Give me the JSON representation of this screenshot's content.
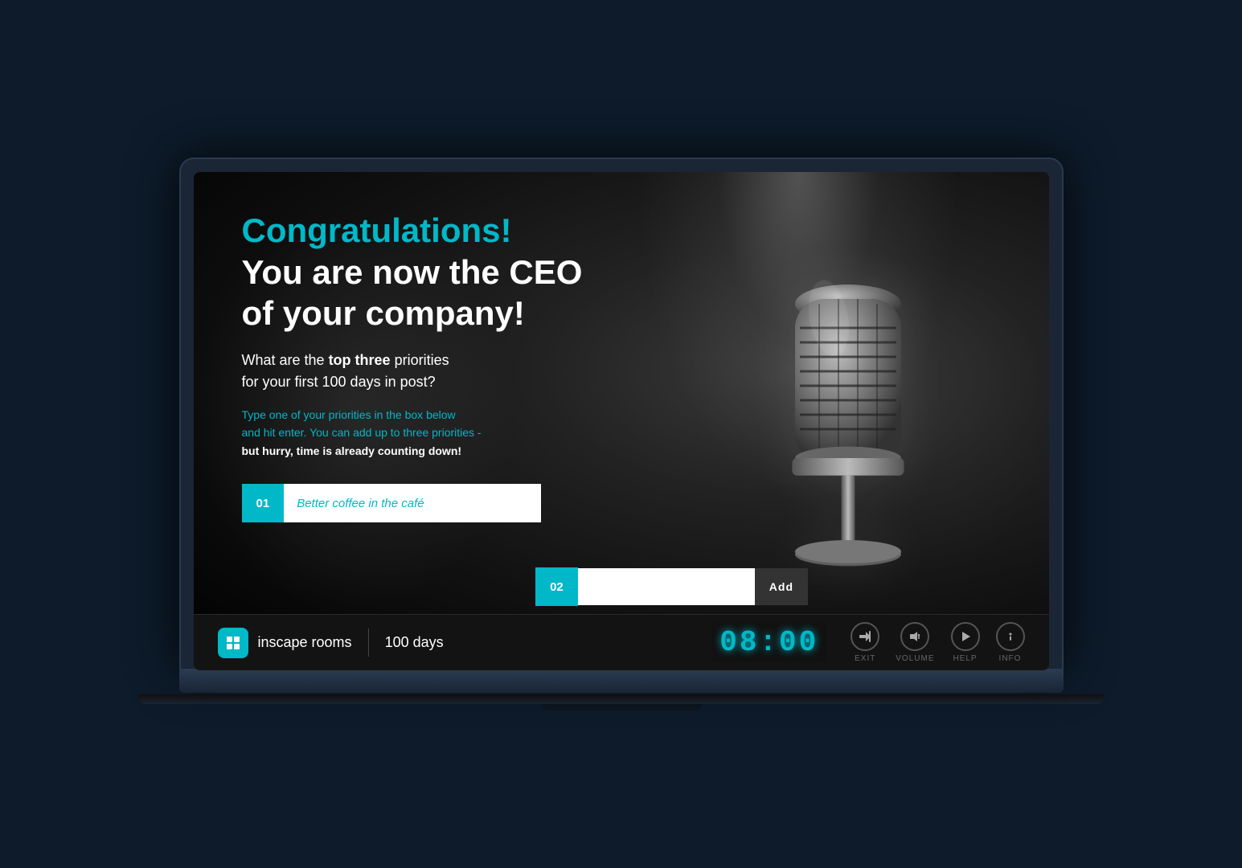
{
  "screen": {
    "title": "Congratulations!",
    "subtitle": "You are now the CEO\nof your company!",
    "question": "What are the top three priorities\nfor your first 100 days in post?",
    "instruction_normal": "Type one of your priorities in the box below\nand hit enter. You can add up to three priorities -",
    "instruction_bold": "but hurry, time is already counting down!",
    "priority1_number": "01",
    "priority1_value": "Better coffee in the café",
    "priority2_number": "02",
    "priority2_value": "",
    "add_label": "Add"
  },
  "bottom_bar": {
    "logo_text": "inscape rooms",
    "divider": "|",
    "days_label": "100 days",
    "timer": "08:00",
    "controls": [
      {
        "label": "EXIT",
        "icon": "⏏"
      },
      {
        "label": "VOLUME",
        "icon": "🔇"
      },
      {
        "label": "HELP",
        "icon": "▶"
      },
      {
        "label": "INFO",
        "icon": "ℹ"
      }
    ]
  },
  "colors": {
    "accent": "#00b8c8",
    "background": "#0d1b2a",
    "screen_bg": "#1a1a1a"
  }
}
